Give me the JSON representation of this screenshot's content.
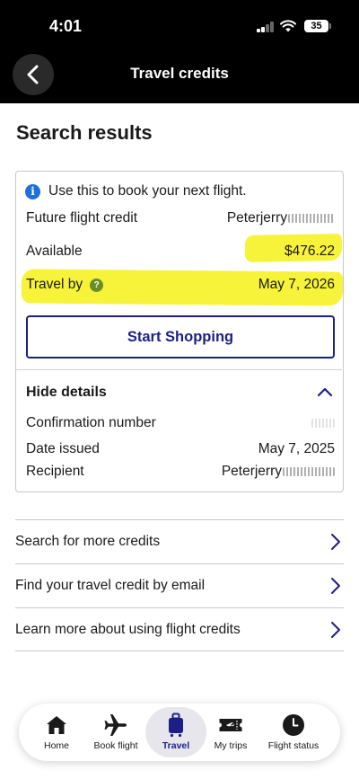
{
  "status_bar": {
    "time": "4:01",
    "battery": "35"
  },
  "header": {
    "title": "Travel credits",
    "back_icon": "chevron-left-icon"
  },
  "page": {
    "title": "Search results"
  },
  "credit_card": {
    "info_text": "Use this to book your next flight.",
    "future_credit_label": "Future flight credit",
    "future_credit_value": "Peterjerry",
    "available_label": "Available",
    "available_value": "$476.22",
    "travel_by_label": "Travel by",
    "travel_by_value": "May 7, 2026",
    "start_shopping_label": "Start Shopping",
    "details_toggle_label": "Hide details",
    "confirmation_label": "Confirmation number",
    "date_issued_label": "Date issued",
    "date_issued_value": "May 7, 2025",
    "recipient_label": "Recipient",
    "recipient_value": "Peterjerry"
  },
  "links": [
    {
      "label": "Search for more credits"
    },
    {
      "label": "Find your travel credit by email"
    },
    {
      "label": "Learn more about using flight credits"
    }
  ],
  "tabs": [
    {
      "label": "Home",
      "icon": "home-icon"
    },
    {
      "label": "Book flight",
      "icon": "airplane-icon"
    },
    {
      "label": "Travel",
      "icon": "luggage-icon",
      "active": true
    },
    {
      "label": "My trips",
      "icon": "ticket-icon"
    },
    {
      "label": "Flight status",
      "icon": "clock-icon"
    }
  ],
  "colors": {
    "brand_navy": "#1c1f87",
    "highlight": "#f7f33a",
    "info_blue": "#1f6fd8",
    "help_green": "#6b8e23"
  }
}
